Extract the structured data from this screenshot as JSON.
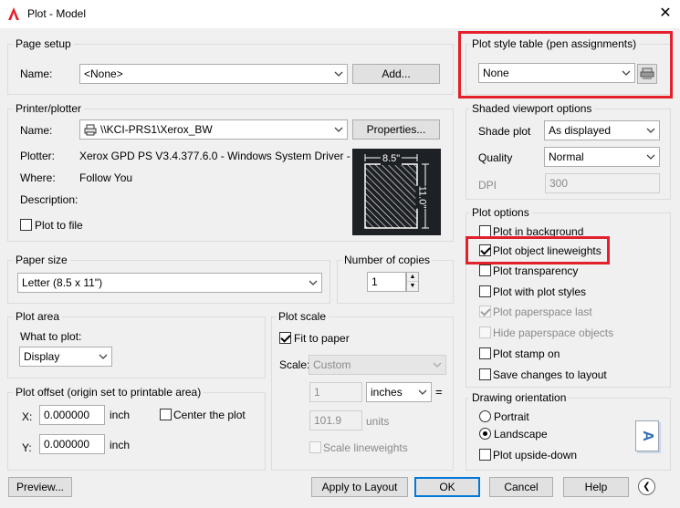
{
  "window": {
    "title": "Plot - Model"
  },
  "page_setup": {
    "legend": "Page setup",
    "name_label": "Name:",
    "name_value": "<None>",
    "add_button": "Add..."
  },
  "printer": {
    "legend": "Printer/plotter",
    "name_label": "Name:",
    "name_value": "\\\\KCI-PRS1\\Xerox_BW",
    "properties_button": "Properties...",
    "plotter_label": "Plotter:",
    "plotter_value": "Xerox GPD PS V3.4.377.6.0 - Windows System Driver - ...",
    "where_label": "Where:",
    "where_value": "Follow You",
    "description_label": "Description:",
    "plot_to_file_label": "Plot to file",
    "preview_width": "8.5\"",
    "preview_height": "11.0\""
  },
  "paper_size": {
    "legend": "Paper size",
    "value": "Letter (8.5 x 11\")"
  },
  "copies": {
    "legend": "Number of copies",
    "value": "1"
  },
  "plot_area": {
    "legend": "Plot area",
    "what_label": "What to plot:",
    "what_value": "Display"
  },
  "plot_scale": {
    "legend": "Plot scale",
    "fit_label": "Fit to paper",
    "scale_label": "Scale:",
    "scale_value": "Custom",
    "value1": "1",
    "unit_value": "inches",
    "equals": "=",
    "value2": "101.9",
    "units_label": "units",
    "scale_lineweights_label": "Scale lineweights"
  },
  "plot_offset": {
    "legend": "Plot offset (origin set to printable area)",
    "x_label": "X:",
    "x_value": "0.000000",
    "x_unit": "inch",
    "y_label": "Y:",
    "y_value": "0.000000",
    "y_unit": "inch",
    "center_label": "Center the plot"
  },
  "plot_style": {
    "legend": "Plot style table (pen assignments)",
    "value": "None"
  },
  "shaded": {
    "legend": "Shaded viewport options",
    "shade_label": "Shade plot",
    "shade_value": "As displayed",
    "quality_label": "Quality",
    "quality_value": "Normal",
    "dpi_label": "DPI",
    "dpi_value": "300"
  },
  "plot_options": {
    "legend": "Plot options",
    "items": [
      {
        "label": "Plot in background",
        "checked": false,
        "disabled": false
      },
      {
        "label": "Plot object lineweights",
        "checked": true,
        "disabled": false
      },
      {
        "label": "Plot transparency",
        "checked": false,
        "disabled": false
      },
      {
        "label": "Plot with plot styles",
        "checked": false,
        "disabled": false
      },
      {
        "label": "Plot paperspace last",
        "checked": true,
        "disabled": true
      },
      {
        "label": "Hide paperspace objects",
        "checked": false,
        "disabled": true
      },
      {
        "label": "Plot stamp on",
        "checked": false,
        "disabled": false
      },
      {
        "label": "Save changes to layout",
        "checked": false,
        "disabled": false
      }
    ]
  },
  "orientation": {
    "legend": "Drawing orientation",
    "portrait": "Portrait",
    "landscape": "Landscape",
    "upside_down": "Plot upside-down",
    "icon_letter": "A"
  },
  "footer": {
    "preview": "Preview...",
    "apply": "Apply to Layout",
    "ok": "OK",
    "cancel": "Cancel",
    "help": "Help"
  },
  "colors": {
    "highlight": "#e3202b",
    "accent": "#0078d7",
    "preview_bg": "#1d2025"
  }
}
